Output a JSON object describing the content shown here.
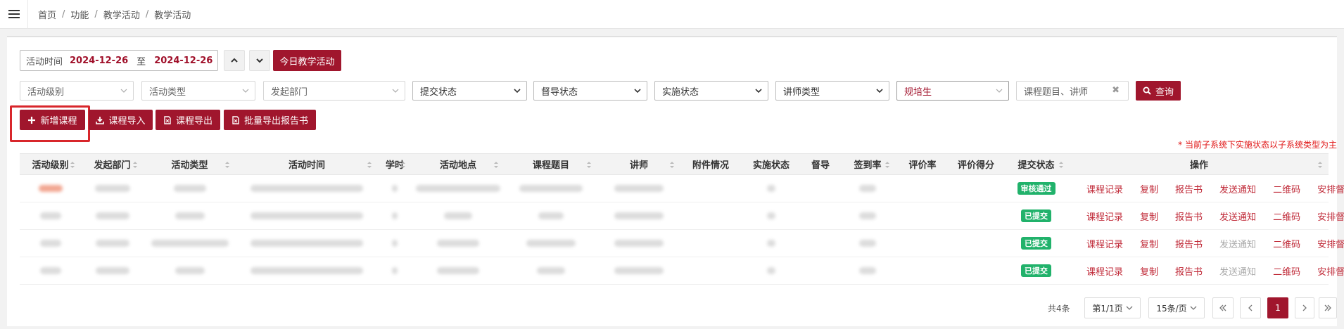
{
  "breadcrumb": [
    "首页",
    "功能",
    "教学活动",
    "教学活动"
  ],
  "date_range": {
    "label": "活动时间",
    "start": "2024-12-26",
    "to": "至",
    "end": "2024-12-26"
  },
  "today_button": "今日教学活动",
  "filters": {
    "level": "活动级别",
    "type": "活动类型",
    "dept": "发起部门",
    "submit": "提交状态",
    "supervise": "督导状态",
    "impl": "实施状态",
    "teacher_type": "讲师类型",
    "trainee": "规培生",
    "search_placeholder": "课程题目、讲师",
    "clear": "✖",
    "query": "查询"
  },
  "actions": {
    "add": "新增课程",
    "import": "课程导入",
    "export": "课程导出",
    "batch_export": "批量导出报告书"
  },
  "notice": "* 当前子系统下实施状态以子系统类型为主",
  "table": {
    "headers": [
      "活动级别",
      "发起部门",
      "活动类型",
      "活动时间",
      "学时",
      "活动地点",
      "课程题目",
      "讲师",
      "附件情况",
      "实施状态",
      "督导",
      "签到率",
      "评价率",
      "评价得分",
      "提交状态",
      "操作"
    ],
    "rows": [
      {
        "status": "审核通过",
        "ops": [
          "课程记录",
          "复制",
          "报告书",
          "发送通知",
          "二维码",
          "安排督导"
        ]
      },
      {
        "status": "已提交",
        "ops": [
          "课程记录",
          "复制",
          "报告书",
          "发送通知",
          "二维码",
          "安排督导"
        ]
      },
      {
        "status": "已提交",
        "ops": [
          "课程记录",
          "复制",
          "报告书",
          "发送通知",
          "二维码",
          "安排督导"
        ]
      },
      {
        "status": "已提交",
        "ops": [
          "课程记录",
          "复制",
          "报告书",
          "发送通知",
          "二维码",
          "安排督导"
        ]
      }
    ]
  },
  "pagination": {
    "total": "共4条",
    "page_select": "第1/1页",
    "size_select": "15条/页",
    "current": "1"
  },
  "colors": {
    "brand": "#a0162d",
    "success": "#21b26b",
    "warning_text": "#e01414"
  }
}
